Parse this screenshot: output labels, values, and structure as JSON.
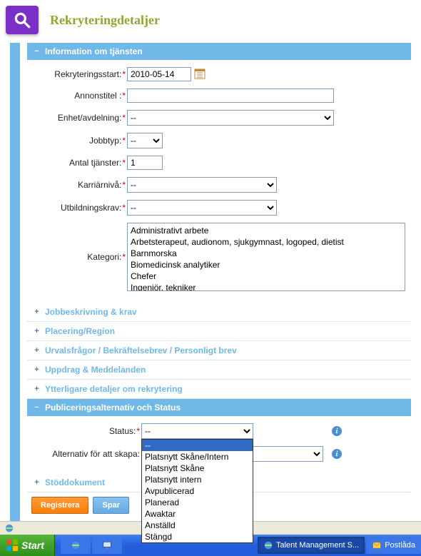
{
  "page_title": "Rekryteringdetaljer",
  "sections": {
    "info": {
      "title": "Information om tjänsten",
      "labels": {
        "rekryteringsstart": "Rekryteringsstart:",
        "annonstitel": "Annonstitel :",
        "enhet": "Enhet/avdelning:",
        "jobbtyp": "Jobbtyp:",
        "antal": "Antal tjänster:",
        "karriar": "Karriärnivå:",
        "utbildning": "Utbildningskrav:",
        "kategori": "Kategori:"
      },
      "values": {
        "rekryteringsstart": "2010-05-14",
        "annonstitel": "",
        "enhet": "--",
        "jobbtyp": "--",
        "antal": "1",
        "karriar": "--",
        "utbildning": "--"
      },
      "kategori_options": [
        "Administrativt arbete",
        "Arbetsterapeut, audionom, sjukgymnast, logoped, dietist",
        "Barnmorska",
        "Biomedicinsk analytiker",
        "Chefer",
        "Ingenjör, tekniker"
      ]
    },
    "collapsed": {
      "jobbeskrivning": "Jobbeskrivning & krav",
      "placering": "Placering/Region",
      "urval": "Urvalsfrågor / Bekräftelsebrev / Personligt brev",
      "uppdrag": "Uppdrag & Meddelanden",
      "ytterligare": "Ytterligare detaljer om rekrytering"
    },
    "publicering": {
      "title": "Publiceringsalternativ och Status",
      "labels": {
        "status": "Status:",
        "alternativ": "Alternativ för att skapa:"
      },
      "values": {
        "status": "--",
        "alternativ": ""
      },
      "status_options": [
        "--",
        "Platsnytt Skåne/Intern",
        "Platsnytt Skåne",
        "Platsnytt intern",
        "Avpublicerad",
        "Planerad",
        "Awaktar",
        "Anställd",
        "Stängd"
      ]
    },
    "stoddokument": "Stöddokument"
  },
  "buttons": {
    "registrera": "Registrera",
    "spara": "Spar"
  },
  "taskbar": {
    "start": "Start",
    "task1": "Talent Management S...",
    "task2": "Postlåda"
  }
}
